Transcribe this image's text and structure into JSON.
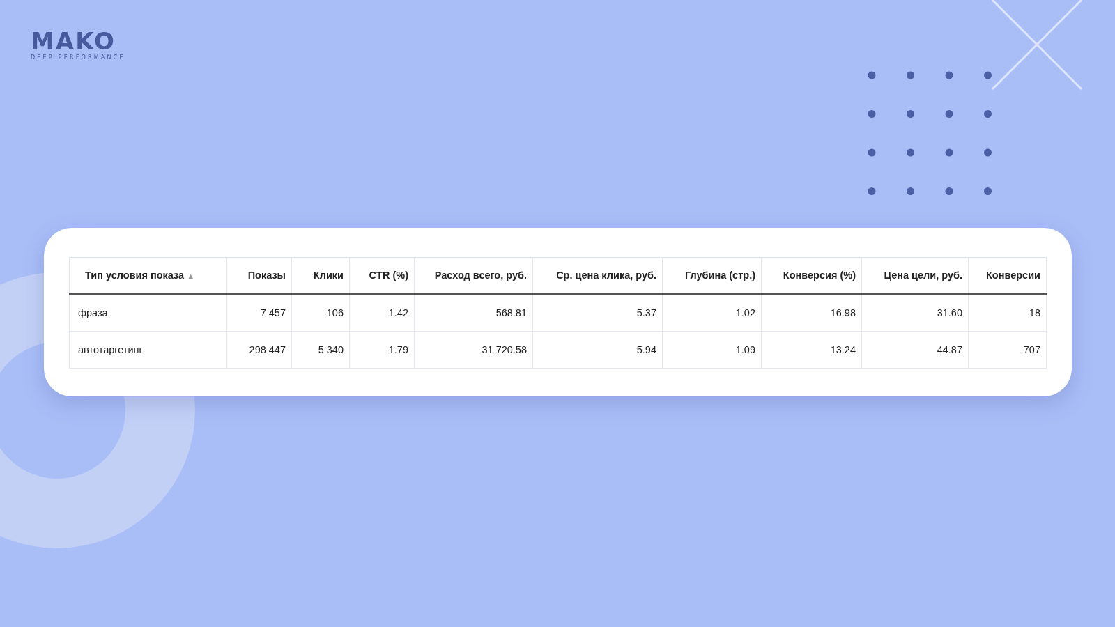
{
  "logo": {
    "wordmark": "MAKO",
    "tagline": "DEEP PERFORMANCE"
  },
  "table": {
    "columns": [
      {
        "label": "Тип условия показа",
        "sort": "▲"
      },
      {
        "label": "Показы"
      },
      {
        "label": "Клики"
      },
      {
        "label": "CTR (%)"
      },
      {
        "label": "Расход всего, руб."
      },
      {
        "label": "Ср. цена клика, руб."
      },
      {
        "label": "Глубина (стр.)"
      },
      {
        "label": "Конверсия (%)"
      },
      {
        "label": "Цена цели, руб."
      },
      {
        "label": "Конверсии"
      }
    ],
    "rows": [
      [
        "фраза",
        "7 457",
        "106",
        "1.42",
        "568.81",
        "5.37",
        "1.02",
        "16.98",
        "31.60",
        "18"
      ],
      [
        "автотаргетинг",
        "298 447",
        "5 340",
        "1.79",
        "31 720.58",
        "5.94",
        "1.09",
        "13.24",
        "44.87",
        "707"
      ]
    ]
  }
}
